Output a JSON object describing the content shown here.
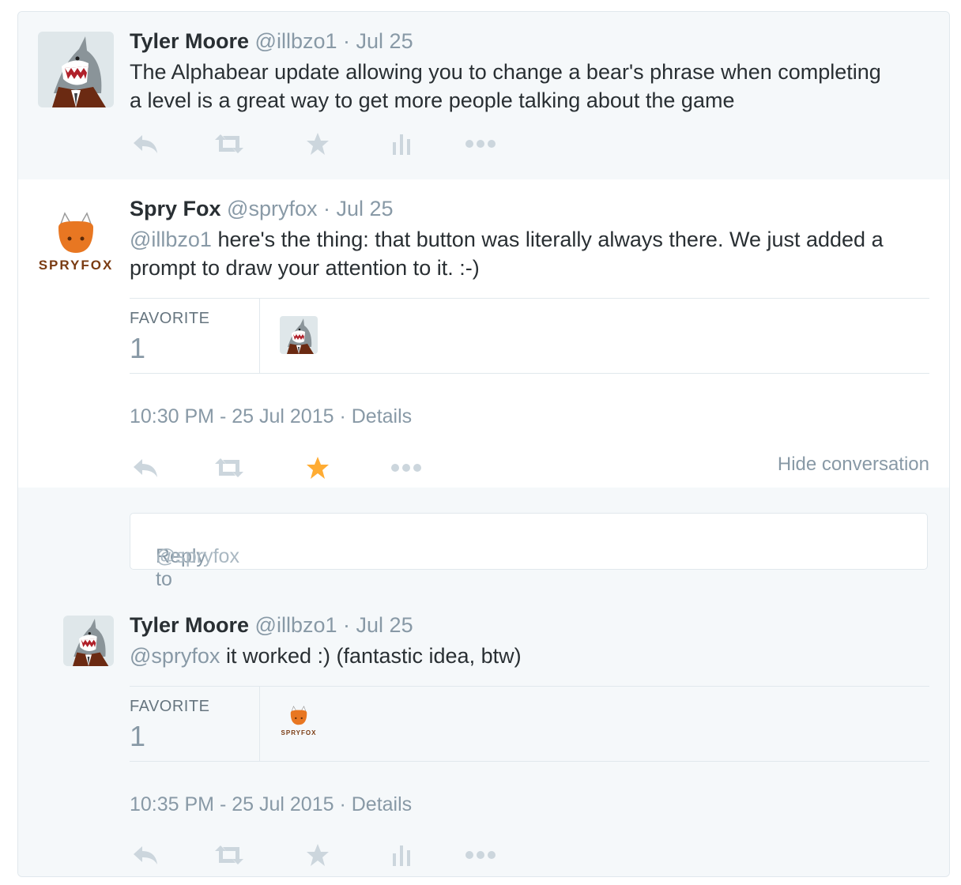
{
  "tweets": [
    {
      "name": "Tyler Moore",
      "handle": "@illbzo1",
      "dot": "·",
      "date": "Jul 25",
      "text_line1": "The Alphabear update allowing you to change a bear's phrase when completing",
      "text_line2": "a level is a great way to get more people talking about the game",
      "avatar_icon": "shark-avatar-icon"
    },
    {
      "name": "Spry Fox",
      "handle": "@spryfox",
      "dot": "·",
      "date": "Jul 25",
      "mention": "@illbzo1",
      "text_line1_rest": " here's the thing: that button was literally always there. We just added a",
      "text_line2": "prompt to draw your attention to it. :-)",
      "avatar_icon": "spryfox-logo-icon",
      "avatar_label": "SPRYFOX",
      "stat_label": "FAVORITE",
      "stat_count": "1",
      "timestamp": "10:30 PM - 25 Jul 2015",
      "details": "Details",
      "hide_conversation": "Hide conversation",
      "favorited": true
    },
    {
      "name": "Tyler Moore",
      "handle": "@illbzo1",
      "dot": "·",
      "date": "Jul 25",
      "mention": "@spryfox",
      "text_rest": " it worked :)  (fantastic idea, btw)",
      "avatar_icon": "shark-avatar-icon",
      "stat_label": "FAVORITE",
      "stat_count": "1",
      "timestamp": "10:35 PM - 25 Jul 2015",
      "details": "Details",
      "favoriter_label": "SPRYFOX"
    }
  ],
  "reply": {
    "prefix": "Reply to ",
    "handle": "@spryfox"
  },
  "colors": {
    "accent_star": "#ffac33",
    "muted": "#8899a6",
    "icon": "#ccd6dd",
    "fox_orange": "#e87722",
    "fox_text": "#7a3b12"
  }
}
